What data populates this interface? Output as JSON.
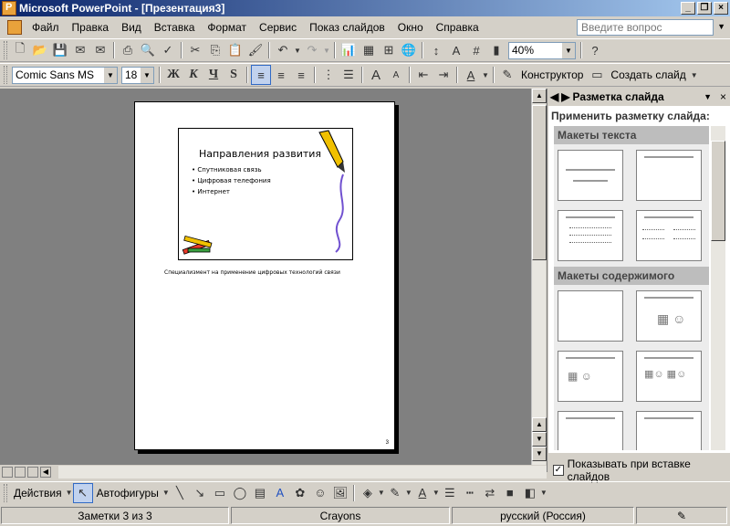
{
  "window": {
    "title": "Microsoft PowerPoint - [Презентация3]"
  },
  "menu": {
    "items": [
      "Файл",
      "Правка",
      "Вид",
      "Вставка",
      "Формат",
      "Сервис",
      "Показ слайдов",
      "Окно",
      "Справка"
    ],
    "help_placeholder": "Введите вопрос"
  },
  "toolbar_standard": {
    "zoom": "40%"
  },
  "toolbar_format": {
    "font": "Comic Sans MS",
    "size": "18",
    "bold": "Ж",
    "italic": "К",
    "underline": "Ч",
    "shadow": "S",
    "designer": "Конструктор",
    "new_slide": "Создать слайд"
  },
  "slide": {
    "title": "Направления развития",
    "bullets": [
      "Спутниковая связь",
      "Цифровая телефония",
      "Интернет"
    ],
    "notes": "Специализмент на применение цифровых технологий связи",
    "page_number": "3"
  },
  "taskpane": {
    "title": "Разметка слайда",
    "prompt": "Применить разметку слайда:",
    "section_text": "Макеты текста",
    "section_content": "Макеты содержимого",
    "checkbox_label": "Показывать при вставке слайдов"
  },
  "drawing": {
    "actions": "Действия",
    "autoshapes": "Автофигуры"
  },
  "status": {
    "notes_counter": "Заметки 3 из 3",
    "design": "Crayons",
    "language": "русский (Россия)"
  }
}
